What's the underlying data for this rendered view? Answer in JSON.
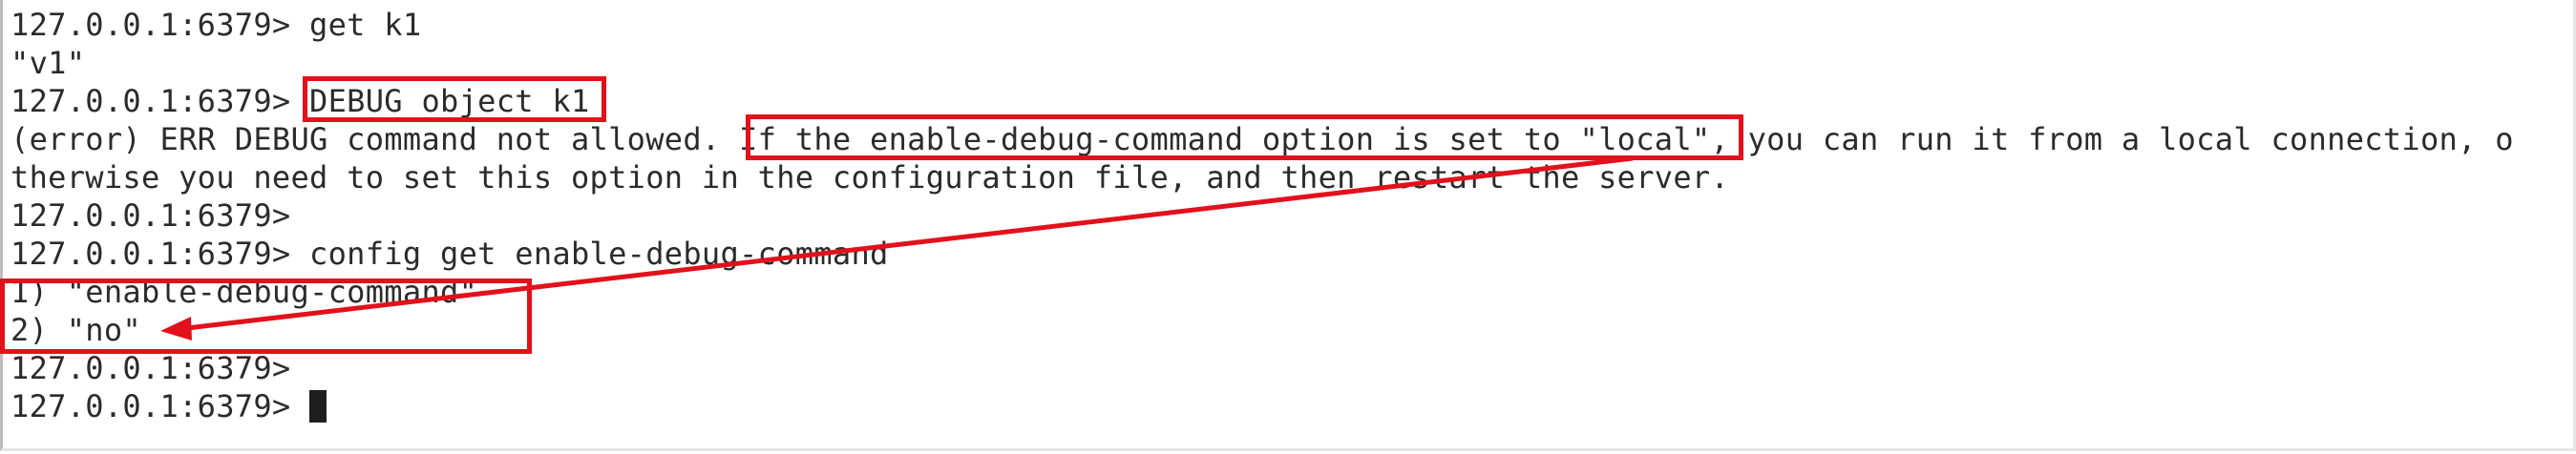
{
  "terminal": {
    "lines": [
      "127.0.0.1:6379> get k1",
      "\"v1\"",
      "127.0.0.1:6379> DEBUG object k1",
      "(error) ERR DEBUG command not allowed. If the enable-debug-command option is set to \"local\", you can run it from a local connection, o",
      "therwise you need to set this option in the configuration file, and then restart the server.",
      "127.0.0.1:6379>",
      "127.0.0.1:6379> config get enable-debug-command",
      "1) \"enable-debug-command\"",
      "2) \"no\"",
      "127.0.0.1:6379>",
      "127.0.0.1:6379> "
    ]
  },
  "colors": {
    "text": "#2b2b2b",
    "annotation": "#e2111b",
    "background": "#ffffff"
  }
}
